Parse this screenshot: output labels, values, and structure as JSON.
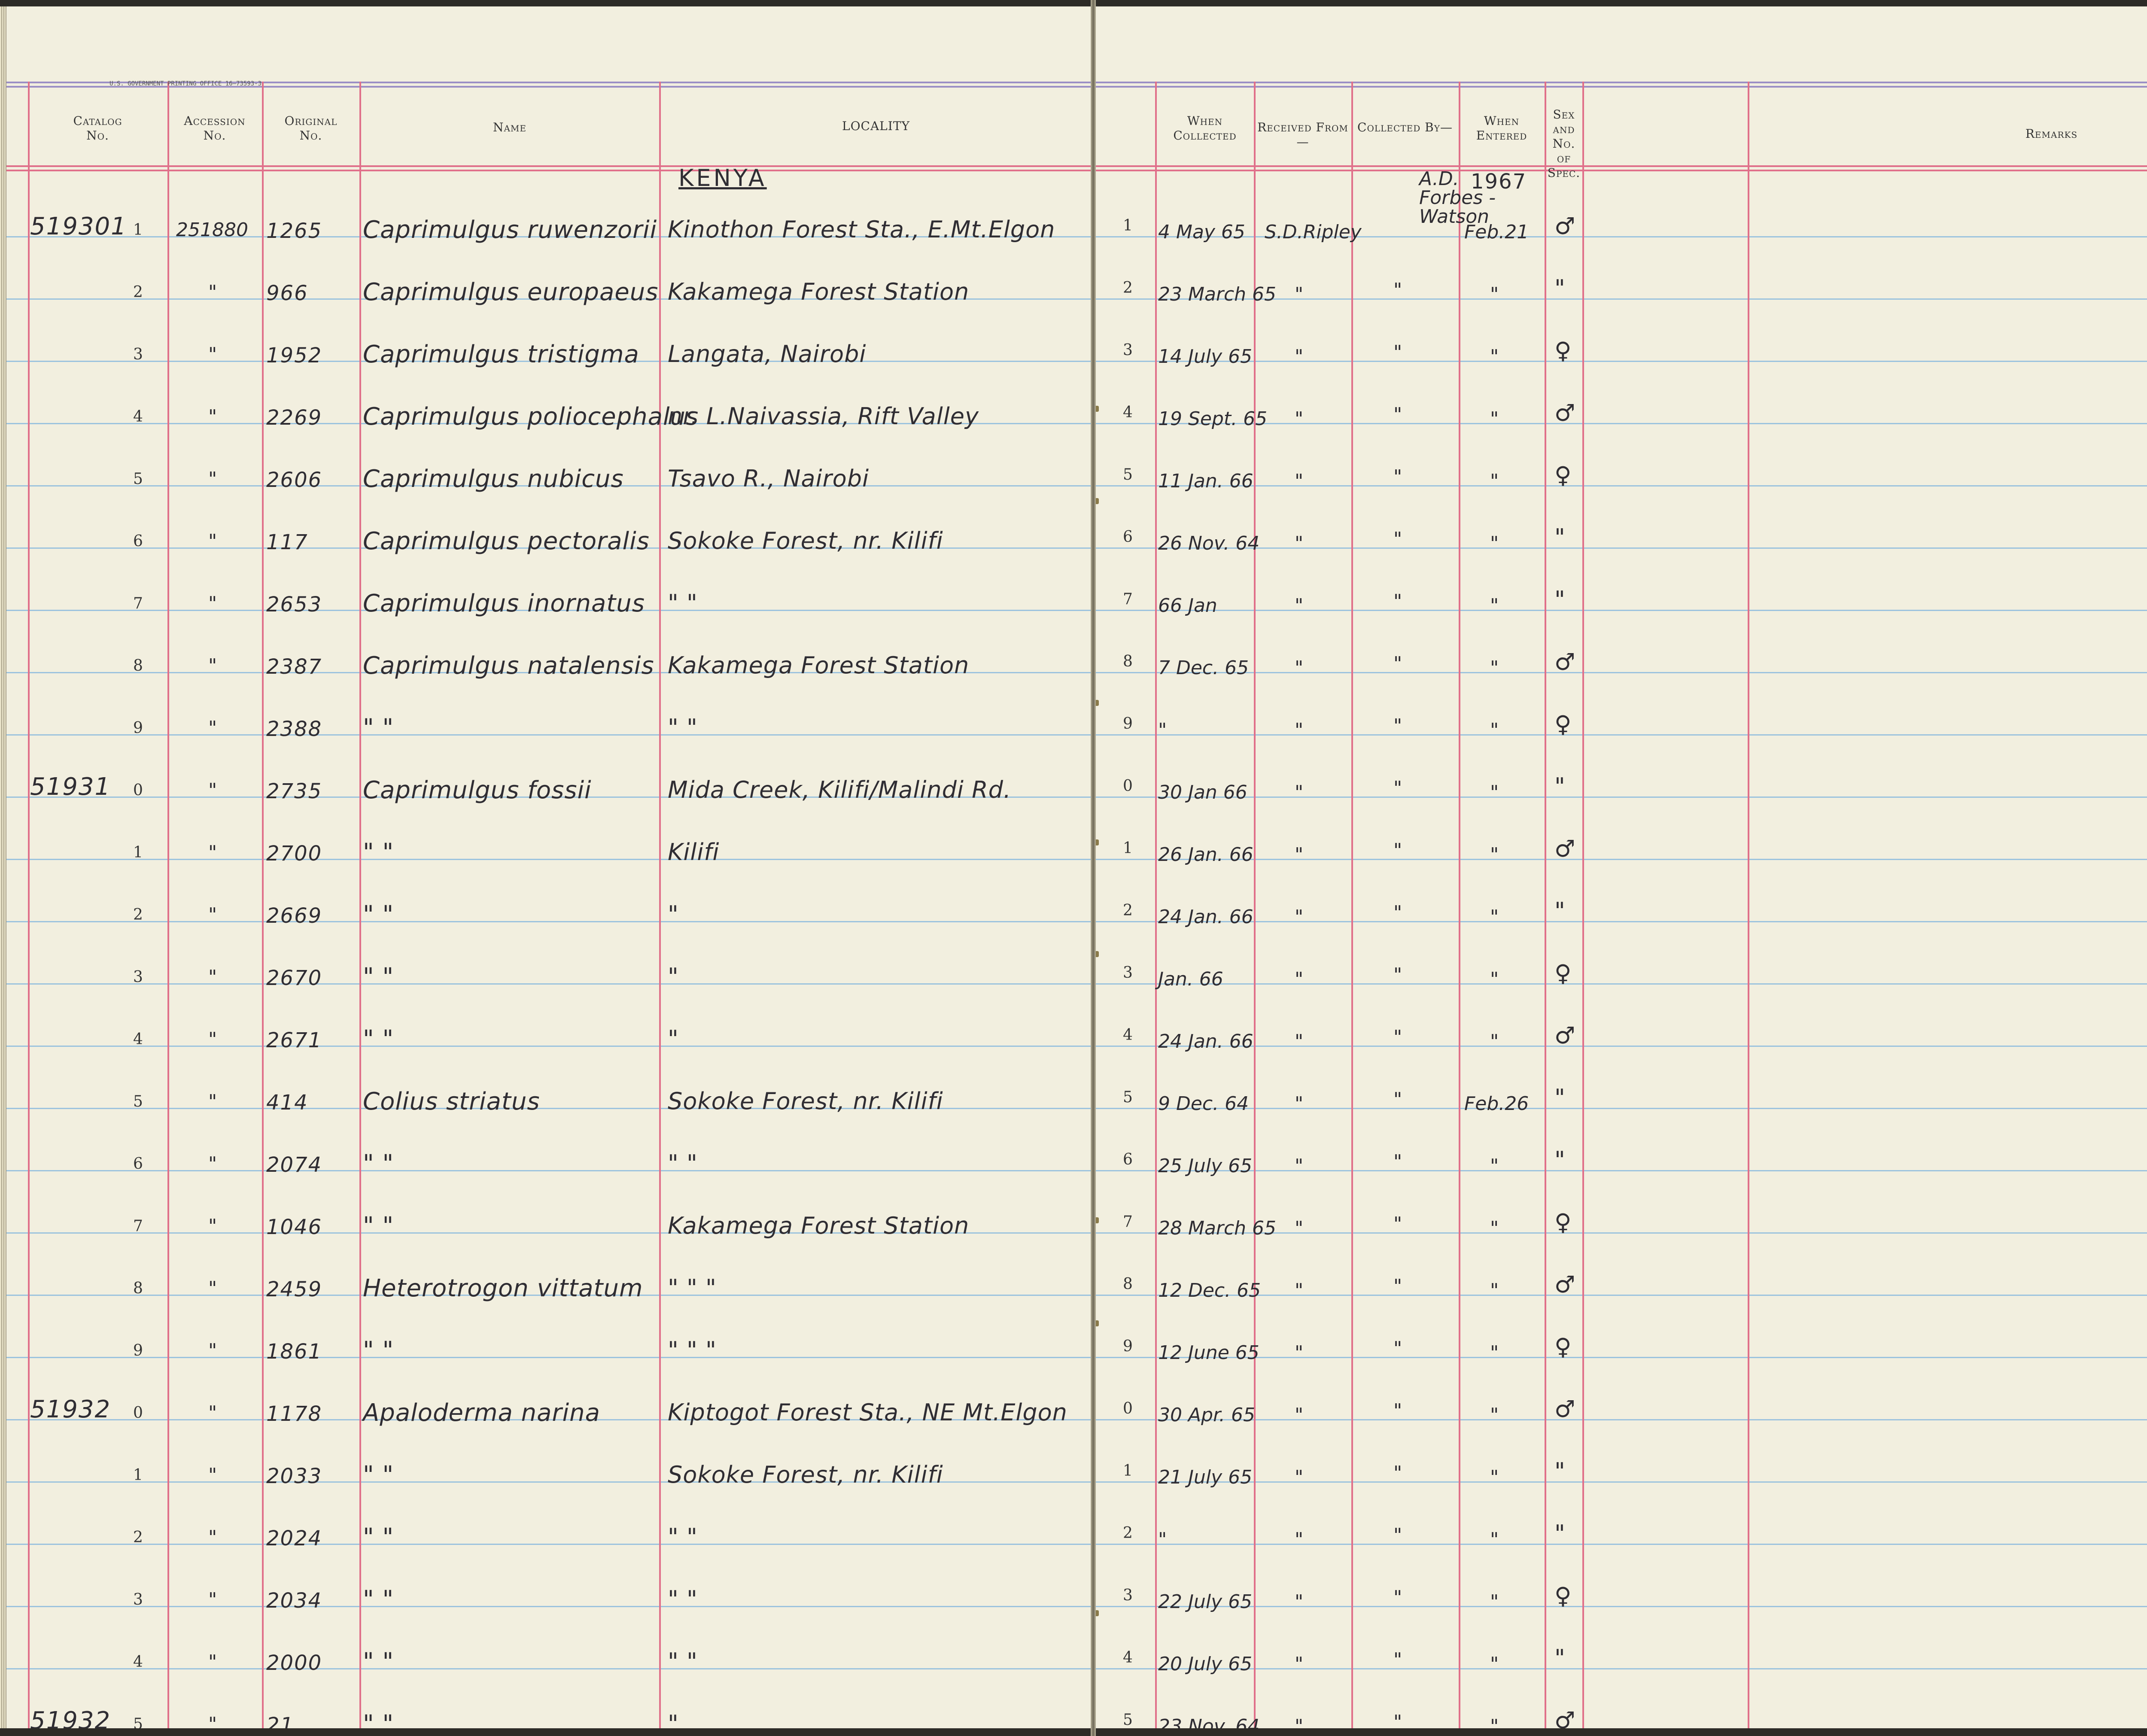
{
  "headers": {
    "catalog": [
      "Catalog",
      "No."
    ],
    "accession": [
      "Accession",
      "No."
    ],
    "original": [
      "Original",
      "No."
    ],
    "name": "Name",
    "locality": "LOCALITY",
    "when_collected": [
      "When",
      "Collected"
    ],
    "received_from": "Received From—",
    "collected_by": "Collected By—",
    "when_entered": [
      "When",
      "Entered"
    ],
    "sex": [
      "Sex and",
      "No. of",
      "Spec."
    ],
    "remarks": "Remarks"
  },
  "printer_note": "U.S. GOVERNMENT PRINTING OFFICE    16—73593-3",
  "country_heading": "KENYA",
  "collector_heading": [
    "A.D.",
    "Forbes -",
    "Watson"
  ],
  "year_heading": "1967",
  "received_first": "S.D.Ripley",
  "entered_first": "Feb.21",
  "entered_second": "Feb.26",
  "rows": [
    {
      "idx": "1",
      "catalog": "519301",
      "cat_sup": "1",
      "accession": "251880",
      "original": "1265",
      "name": "Caprimulgus ruwenzorii",
      "locality": "Kinothon Forest Sta., E.Mt.Elgon",
      "ridx": "1",
      "when": "4 May 65",
      "sex": "♂"
    },
    {
      "idx": "2",
      "catalog": "",
      "accession": "\"",
      "original": "966",
      "name": "Caprimulgus europaeus",
      "locality": "Kakamega Forest Station",
      "ridx": "2",
      "when": "23 March 65",
      "sex": "\""
    },
    {
      "idx": "3",
      "catalog": "",
      "accession": "\"",
      "original": "1952",
      "name": "Caprimulgus tristigma",
      "locality": "Langata, Nairobi",
      "ridx": "3",
      "when": "14 July 65",
      "sex": "♀"
    },
    {
      "idx": "4",
      "catalog": "",
      "accession": "\"",
      "original": "2269",
      "name": "Caprimulgus poliocephalus",
      "locality": "nr. L.Naivassia, Rift Valley",
      "ridx": "4",
      "when": "19 Sept. 65",
      "sex": "♂"
    },
    {
      "idx": "5",
      "catalog": "",
      "accession": "\"",
      "original": "2606",
      "name": "Caprimulgus nubicus",
      "locality": "Tsavo R., Nairobi",
      "ridx": "5",
      "when": "11 Jan. 66",
      "sex": "♀"
    },
    {
      "idx": "6",
      "catalog": "",
      "accession": "\"",
      "original": "117",
      "name": "Caprimulgus pectoralis",
      "locality": "Sokoke Forest, nr. Kilifi",
      "ridx": "6",
      "when": "26 Nov. 64",
      "sex": "\""
    },
    {
      "idx": "7",
      "catalog": "",
      "accession": "\"",
      "original": "2653",
      "name": "Caprimulgus inornatus",
      "locality": "\"          \"",
      "ridx": "7",
      "when": "66 Jan",
      "sex": "\""
    },
    {
      "idx": "8",
      "catalog": "",
      "accession": "\"",
      "original": "2387",
      "name": "Caprimulgus natalensis",
      "locality": "Kakamega Forest Station",
      "ridx": "8",
      "when": "7 Dec. 65",
      "sex": "♂"
    },
    {
      "idx": "9",
      "catalog": "",
      "accession": "\"",
      "original": "2388",
      "name": "\"          \"",
      "locality": "\"          \"",
      "ridx": "9",
      "when": "\"",
      "sex": "♀"
    },
    {
      "idx": "0",
      "catalog": "51931",
      "accession": "\"",
      "original": "2735",
      "name": "Caprimulgus fossii",
      "locality": "Mida Creek, Kilifi/Malindi Rd.",
      "ridx": "0",
      "when": "30 Jan 66",
      "sex": "\""
    },
    {
      "idx": "1",
      "catalog": "",
      "accession": "\"",
      "original": "2700",
      "name": "\"          \"",
      "locality": "Kilifi",
      "ridx": "1",
      "when": "26 Jan. 66",
      "sex": "♂"
    },
    {
      "idx": "2",
      "catalog": "",
      "accession": "\"",
      "original": "2669",
      "name": "\"          \"",
      "locality": "\"",
      "ridx": "2",
      "when": "24 Jan. 66",
      "sex": "\""
    },
    {
      "idx": "3",
      "catalog": "",
      "accession": "\"",
      "original": "2670",
      "name": "\"          \"",
      "locality": "\"",
      "ridx": "3",
      "when": "Jan. 66",
      "sex": "♀"
    },
    {
      "idx": "4",
      "catalog": "",
      "accession": "\"",
      "original": "2671",
      "name": "\"          \"",
      "locality": "\"",
      "ridx": "4",
      "when": "24 Jan. 66",
      "sex": "♂"
    },
    {
      "idx": "5",
      "catalog": "",
      "accession": "\"",
      "original": "414",
      "name": "Colius striatus",
      "locality": "Sokoke Forest, nr. Kilifi",
      "ridx": "5",
      "when": "9 Dec. 64",
      "sex": "\""
    },
    {
      "idx": "6",
      "catalog": "",
      "accession": "\"",
      "original": "2074",
      "name": "\"          \"",
      "locality": "\"          \"",
      "ridx": "6",
      "when": "25 July 65",
      "sex": "\""
    },
    {
      "idx": "7",
      "catalog": "",
      "accession": "\"",
      "original": "1046",
      "name": "\"          \"",
      "locality": "Kakamega Forest Station",
      "ridx": "7",
      "when": "28 March 65",
      "sex": "♀"
    },
    {
      "idx": "8",
      "catalog": "",
      "accession": "\"",
      "original": "2459",
      "name": "Heterotrogon vittatum",
      "locality": "\"      \"      \"",
      "ridx": "8",
      "when": "12 Dec. 65",
      "sex": "♂"
    },
    {
      "idx": "9",
      "catalog": "",
      "accession": "\"",
      "original": "1861",
      "name": "\"          \"",
      "locality": "\"      \"      \"",
      "ridx": "9",
      "when": "12 June 65",
      "sex": "♀"
    },
    {
      "idx": "0",
      "catalog": "51932",
      "accession": "\"",
      "original": "1178",
      "name": "Apaloderma narina",
      "locality": "Kiptogot Forest Sta., NE Mt.Elgon",
      "ridx": "0",
      "when": "30 Apr. 65",
      "sex": "♂"
    },
    {
      "idx": "1",
      "catalog": "",
      "accession": "\"",
      "original": "2033",
      "name": "\"          \"",
      "locality": "Sokoke Forest, nr. Kilifi",
      "ridx": "1",
      "when": "21 July 65",
      "sex": "\""
    },
    {
      "idx": "2",
      "catalog": "",
      "accession": "\"",
      "original": "2024",
      "name": "\"          \"",
      "locality": "\"          \"",
      "ridx": "2",
      "when": "\"",
      "sex": "\""
    },
    {
      "idx": "3",
      "catalog": "",
      "accession": "\"",
      "original": "2034",
      "name": "\"          \"",
      "locality": "\"          \"",
      "ridx": "3",
      "when": "22 July 65",
      "sex": "♀"
    },
    {
      "idx": "4",
      "catalog": "",
      "accession": "\"",
      "original": "2000",
      "name": "\"          \"",
      "locality": "\"          \"",
      "ridx": "4",
      "when": "20 July 65",
      "sex": "\""
    },
    {
      "idx": "5",
      "catalog": "51932",
      "accession": "\"",
      "original": "21",
      "name": "\"          \"",
      "locality": "\"",
      "ridx": "5",
      "when": "23 Nov. 64",
      "sex": "♂"
    }
  ],
  "ditto": "\"",
  "colors": {
    "paper": "#f2efdf",
    "rule_blue": "#9cc3de",
    "rule_red": "#e0708a",
    "rule_purple": "#9b8fc5",
    "ink": "#2f2d33"
  }
}
